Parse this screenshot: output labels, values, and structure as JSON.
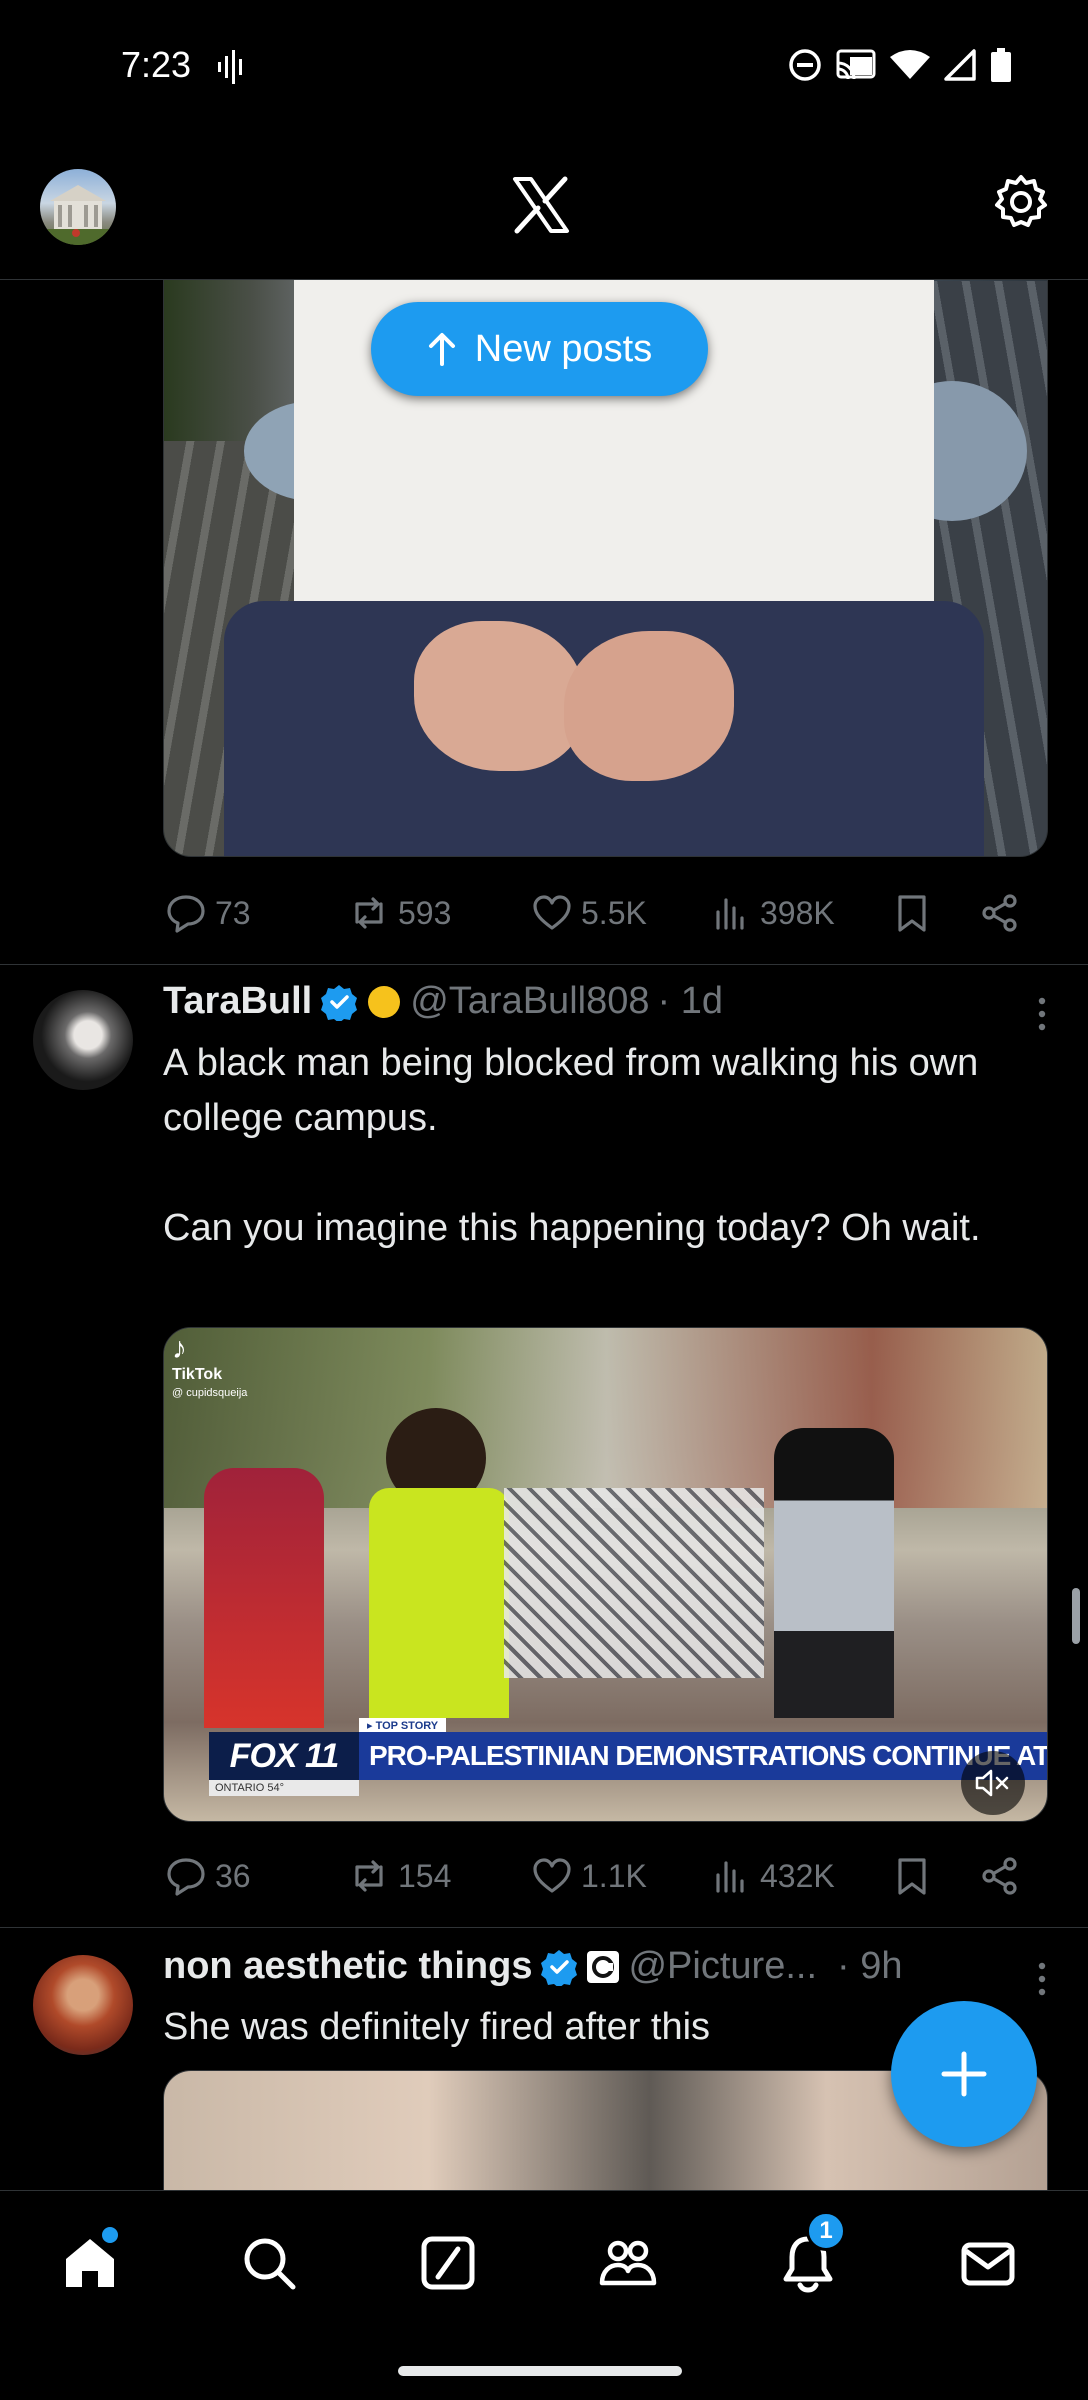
{
  "status_bar": {
    "time": "7:23"
  },
  "top_bar": {
    "logo": "x-logo",
    "settings_icon": "gear-icon"
  },
  "new_posts_pill": {
    "label": "New posts",
    "icon": "arrow-up-icon"
  },
  "posts": [
    {
      "media_desc": "photo-person-white-shirt",
      "stats": {
        "replies": "73",
        "reposts": "593",
        "likes": "5.5K",
        "views": "398K"
      }
    },
    {
      "name": "TaraBull",
      "handle": "@TaraBull808",
      "time": "· 1d",
      "text_line1": "A black man being blocked from walking his own college campus.",
      "text_line2": "Can you imagine this happening today? Oh wait.",
      "video": {
        "tiktok_label": "TikTok",
        "tiktok_user": "@ cupidsqueija",
        "top_story": "▸ TOP STORY",
        "channel": "FOX 11",
        "headline": "PRO-PALESTINIAN DEMONSTRATIONS CONTINUE AT UC",
        "location": "ONTARIO 54°"
      },
      "stats": {
        "replies": "36",
        "reposts": "154",
        "likes": "1.1K",
        "views": "432K"
      }
    },
    {
      "name": "non aesthetic things",
      "handle": "@Picture...",
      "time": "· 9h",
      "text": "She was definitely fired after this"
    }
  ],
  "nav": {
    "items": [
      "home",
      "search",
      "grok",
      "communities",
      "notifications",
      "messages"
    ],
    "notifications_badge": "1"
  },
  "colors": {
    "accent": "#1d9bf0",
    "background": "#000000",
    "muted": "#71767b"
  }
}
